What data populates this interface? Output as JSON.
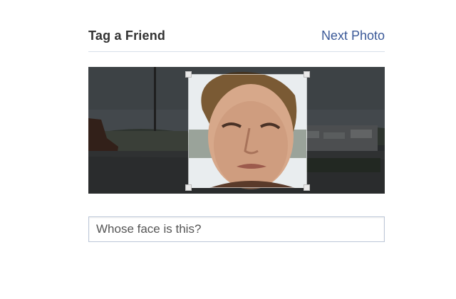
{
  "header": {
    "title": "Tag a Friend",
    "next_label": "Next Photo"
  },
  "photo": {
    "subject": "man-face-harbor-background"
  },
  "tag_input": {
    "placeholder": "Whose face is this?",
    "value": ""
  },
  "colors": {
    "link": "#3b5998",
    "title": "#333333",
    "divider": "#d8dfea",
    "input_border": "#bdc7d8"
  }
}
